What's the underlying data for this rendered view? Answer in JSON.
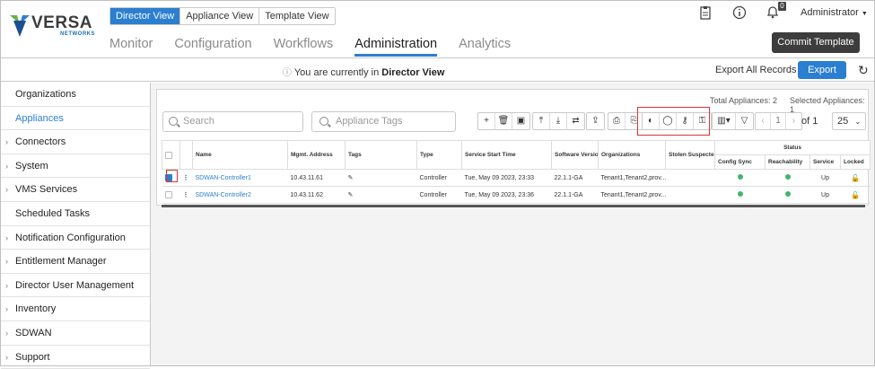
{
  "brand": {
    "name": "VERSA",
    "sub": "NETWORKS"
  },
  "views": [
    "Director View",
    "Appliance View",
    "Template View"
  ],
  "nav": [
    "Monitor",
    "Configuration",
    "Workflows",
    "Administration",
    "Analytics"
  ],
  "header": {
    "admin": "Administrator",
    "notifications": "0",
    "commit": "Commit Template"
  },
  "infobar": {
    "prefix": "You are currently in ",
    "view": "Director View",
    "export_all": "Export All Records",
    "export": "Export"
  },
  "sidebar": [
    {
      "label": "Organizations",
      "chevron": false
    },
    {
      "label": "Appliances",
      "chevron": false,
      "active": true
    },
    {
      "label": "Connectors",
      "chevron": true
    },
    {
      "label": "System",
      "chevron": true
    },
    {
      "label": "VMS Services",
      "chevron": true
    },
    {
      "label": "Scheduled Tasks",
      "chevron": false
    },
    {
      "label": "Notification Configuration",
      "chevron": true
    },
    {
      "label": "Entitlement Manager",
      "chevron": true
    },
    {
      "label": "Director User Management",
      "chevron": true
    },
    {
      "label": "Inventory",
      "chevron": true
    },
    {
      "label": "SDWAN",
      "chevron": true
    },
    {
      "label": "Support",
      "chevron": true
    }
  ],
  "totals": {
    "total": "Total Appliances: 2",
    "selected": "Selected Appliances: 1"
  },
  "search": {
    "placeholder": "Search",
    "tags_placeholder": "Appliance Tags"
  },
  "pager": {
    "page": "1",
    "of": "of",
    "total_pages": "1",
    "page_size": "25"
  },
  "table": {
    "headers": [
      "Name",
      "Mgmt. Address",
      "Tags",
      "Type",
      "Service Start Time",
      "Software Version",
      "Organizations",
      "Stolen Suspected",
      "Status"
    ],
    "status_headers": [
      "Config Sync",
      "Reachability",
      "Service",
      "Locked"
    ],
    "rows": [
      {
        "checked": true,
        "name": "SDWAN-Controller1",
        "mgmt": "10.43.11.61",
        "type": "Controller",
        "start": "Tue, May 09 2023, 23:33",
        "version": "22.1.1-GA",
        "orgs": "Tenant1,Tenant2,prov...",
        "service": "Up"
      },
      {
        "checked": false,
        "name": "SDWAN-Controller2",
        "mgmt": "10.43.11.62",
        "type": "Controller",
        "start": "Tue, May 09 2023, 23:36",
        "version": "22.1.1-GA",
        "orgs": "Tenant1,Tenant2,prov...",
        "service": "Up"
      }
    ]
  },
  "colors": {
    "accent": "#2b7fd0",
    "highlight": "#dd3333",
    "ok": "#45b36b"
  }
}
